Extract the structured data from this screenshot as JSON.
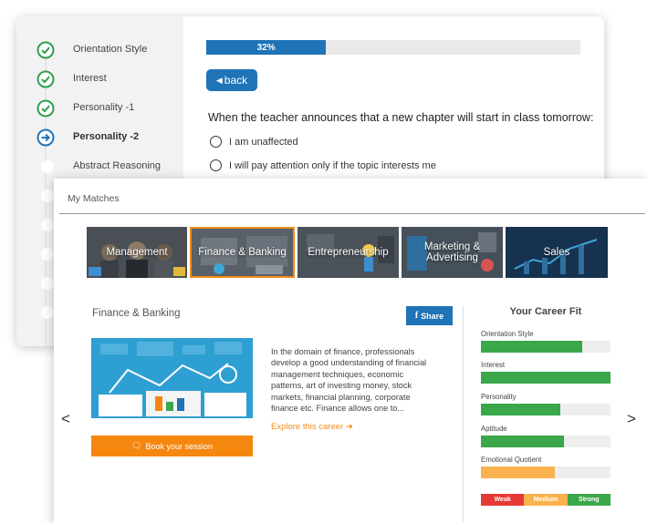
{
  "assessment": {
    "steps": [
      {
        "label": "Orientation Style",
        "state": "done"
      },
      {
        "label": "Interest",
        "state": "done"
      },
      {
        "label": "Personality -1",
        "state": "done"
      },
      {
        "label": "Personality -2",
        "state": "current"
      },
      {
        "label": "Abstract Reasoning",
        "state": "pending"
      }
    ],
    "progress": {
      "percent": 32,
      "text": "32%"
    },
    "back_label": "back",
    "question": "When the teacher announces that a new chapter will start in class tomorrow:",
    "options": [
      "I am unaffected",
      "I will pay attention only if the topic interests me"
    ]
  },
  "matches": {
    "title": "My Matches",
    "tiles": [
      {
        "label": "Management",
        "active": false
      },
      {
        "label": "Finance & Banking",
        "active": true
      },
      {
        "label": "Entrepreneurship",
        "active": false
      },
      {
        "label": "Marketing & Advertising",
        "active": false
      },
      {
        "label": "Sales",
        "active": false
      }
    ],
    "detail": {
      "title": "Finance & Banking",
      "share_label": "Share",
      "description": "In the domain of finance, professionals develop a good understanding of financial management techniques, economic patterns, art of investing money, stock markets, financial planning, corporate finance etc. Finance allows one to...",
      "explore_label": "Explore this career",
      "book_label": "Book your session"
    },
    "nav": {
      "prev": "<",
      "next": ">"
    },
    "career_fit": {
      "title": "Your Career Fit",
      "items": [
        {
          "label": "Orientation Style",
          "value": 0.78,
          "color": "#3aa74a"
        },
        {
          "label": "Interest",
          "value": 1.0,
          "color": "#3aa74a"
        },
        {
          "label": "Personality",
          "value": 0.61,
          "color": "#3aa74a"
        },
        {
          "label": "Aptitude",
          "value": 0.64,
          "color": "#3aa74a"
        },
        {
          "label": "Emotional Quotient",
          "value": 0.57,
          "color": "#f9b24f"
        }
      ],
      "legend": [
        {
          "label": "Weak",
          "color": "#e53935"
        },
        {
          "label": "Medium",
          "color": "#f9b24f"
        },
        {
          "label": "Strong",
          "color": "#3aa74a"
        }
      ]
    }
  },
  "colors": {
    "primary": "#1f73b7",
    "accent": "#f28c1a",
    "success": "#2e9e4f"
  }
}
